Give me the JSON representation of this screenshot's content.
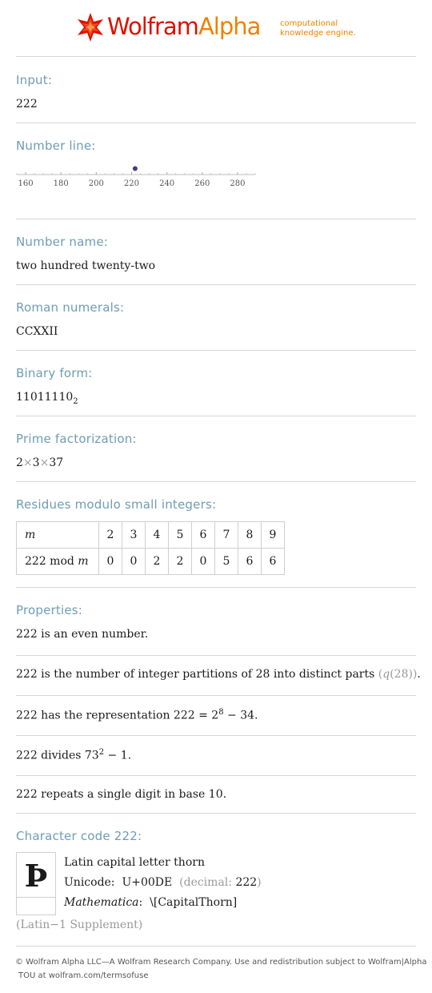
{
  "header": {
    "logo_wolfram": "Wolfram",
    "logo_alpha": "Alpha",
    "tagline_line1": "computational",
    "tagline_line2": "knowledge engine.",
    "brand_red": "#dd1100",
    "brand_orange": "#f08000",
    "logo_icon": "spikey-star-icon"
  },
  "sections": {
    "input": {
      "label": "Input:",
      "value": "222"
    },
    "number_line": {
      "label": "Number line:"
    },
    "number_name": {
      "label": "Number name:",
      "value": "two hundred twenty-two"
    },
    "roman": {
      "label": "Roman numerals:",
      "value": "CCXXII"
    },
    "binary": {
      "label": "Binary form:",
      "value": "11011110",
      "base": "2"
    },
    "prime": {
      "label": "Prime factorization:",
      "f1": "2",
      "f2": "3",
      "f3": "37",
      "times": "×"
    },
    "residues": {
      "label": "Residues modulo small integers:",
      "row1_header": "m",
      "row2_header_a": "222 mod",
      "row2_header_b": "m",
      "moduli": [
        "2",
        "3",
        "4",
        "5",
        "6",
        "7",
        "8",
        "9"
      ],
      "residues": [
        "0",
        "0",
        "2",
        "2",
        "0",
        "5",
        "6",
        "6"
      ]
    },
    "properties": {
      "label": "Properties:",
      "p1": "222 is an even number.",
      "p2_text": "222 is the number of integer partitions of 28 into distinct parts",
      "p2_note_open": "(",
      "p2_note_q": "q",
      "p2_note_rest": "(28))",
      "p2_end": ".",
      "p3_text": "222 has the representation 222 = 2",
      "p3_exp": "8",
      "p3_end": " − 34.",
      "p4_text": "222 divides 73",
      "p4_exp": "2",
      "p4_end": " − 1.",
      "p5": "222 repeats a single digit in base 10."
    },
    "character": {
      "label": "Character code 222:",
      "glyph": "Þ",
      "name": "Latin capital letter thorn",
      "unicode_label": "Unicode:",
      "unicode_value": "U+00DE",
      "decimal_open": "(decimal:",
      "decimal_value": "222",
      "decimal_close": ")",
      "mathematica_label": "Mathematica",
      "mathematica_colon": ":",
      "mathematica_value": "\\[CapitalThorn]",
      "block": "(Latin−1 Supplement)"
    }
  },
  "number_line_chart": {
    "chart_data": {
      "type": "scatter",
      "x": [
        222
      ],
      "y": [
        0
      ],
      "xlim": [
        155,
        290
      ],
      "ticks": [
        160,
        180,
        200,
        220,
        240,
        260,
        280
      ],
      "point_color": "#3b3f8c"
    }
  },
  "footer": {
    "line1": "© Wolfram Alpha LLC—A Wolfram Research Company. Use and redistribution subject to Wolfram|Alpha",
    "line2": "TOU at wolfram.com/termsofuse"
  }
}
